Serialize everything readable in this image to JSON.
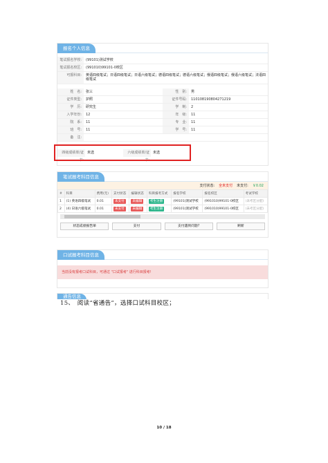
{
  "personal": {
    "title": "报名个人信息",
    "school_label": "笔试报名学校:",
    "school_value": "(99101)测试学校",
    "campus_label": "笔试报名校区:",
    "campus_value": "(991010)99101-0校区",
    "subjects_label": "可报科目:",
    "subjects_value": "英语四级笔试；日语四级笔试；日语六级笔试；德语四级笔试；德语六级笔试；俄语四级笔试；俄语六级笔试；法语四级笔试",
    "fields": [
      {
        "k": "姓　名:",
        "v": "张三"
      },
      {
        "k": "性　别:",
        "v": "男"
      },
      {
        "k": "证件类型:",
        "v": "护照"
      },
      {
        "k": "证件号码:",
        "v": "110108190804271219"
      },
      {
        "k": "学　历:",
        "v": "研究生"
      },
      {
        "k": "学　制:",
        "v": "2"
      },
      {
        "k": "入学年份:",
        "v": "12"
      },
      {
        "k": "年　级:",
        "v": "11"
      },
      {
        "k": "院　系:",
        "v": "11"
      },
      {
        "k": "专　业:",
        "v": "11"
      },
      {
        "k": "班　号:",
        "v": "11"
      },
      {
        "k": "学　号:",
        "v": "11"
      }
    ],
    "remark_label": "备　注:",
    "cet4_label": "四级成绩单/证书:",
    "cet4_value": "未选",
    "cet6_label": "六级成绩单/证书:",
    "cet6_value": "未选"
  },
  "written": {
    "title": "笔试报考科目信息",
    "pay_status_label": "支付状态:",
    "pay_status_value": "全未支付",
    "amount_label": "未支付:",
    "amount_value": "￥0.02",
    "headers": [
      "#",
      "科目",
      "费用(元)",
      "支付状态",
      "编辑状态",
      "科目报考方式",
      "报名学校",
      "报名校区",
      "考试学校"
    ],
    "rows": [
      {
        "no": "1",
        "subject": "(1) 英语四级笔试",
        "fee": "0.01",
        "pay": "未支付",
        "edit": "未编辑",
        "mode": "考生注册",
        "school": "(99101)测试学校",
        "campus": "(991010)99101-0校区",
        "exam_school": "(未考区分配)"
      },
      {
        "no": "2",
        "subject": "(4) 日语六级笔试",
        "fee": "0.01",
        "pay": "未支付",
        "edit": "未编辑",
        "mode": "考生注册",
        "school": "(99101)测试学校",
        "campus": "(991010)99101-0校区",
        "exam_school": "(未考区分配)"
      }
    ],
    "buttons": [
      "状态成绩报告单",
      "支付",
      "支付遇到问题?",
      "刷新"
    ]
  },
  "oral": {
    "title": "口试报考科目信息",
    "notice": "当前没有报考口试科目，可通过 \"口试报考\" 进行科目报考!"
  },
  "announcement": {
    "title": "通告信息"
  },
  "step": "15、　阅读“省通告”，选择口试科目校区；",
  "page": "10 / 18"
}
